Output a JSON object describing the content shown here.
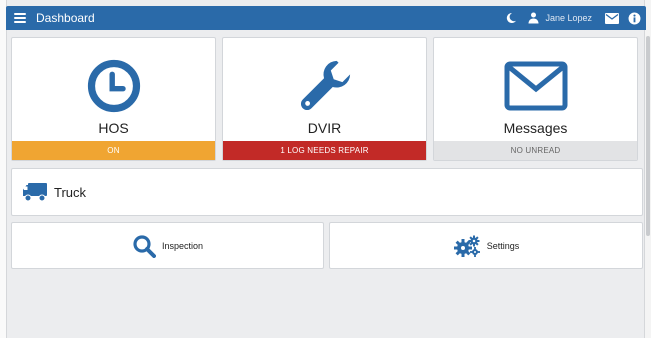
{
  "header": {
    "title": "Dashboard",
    "user_name": "Jane Lopez",
    "icons": [
      "menu-icon",
      "moon-icon",
      "user-icon",
      "envelope-icon",
      "info-icon"
    ]
  },
  "tiles": {
    "hos": {
      "label": "HOS",
      "status": "ON",
      "status_color": "#f0a532",
      "icon": "clock-icon"
    },
    "dvir": {
      "label": "DVIR",
      "status": "1 LOG NEEDS REPAIR",
      "status_color": "#c22a27",
      "icon": "wrench-icon"
    },
    "messages": {
      "label": "Messages",
      "status": "NO UNREAD",
      "status_color": "#e2e3e5",
      "icon": "envelope-icon"
    }
  },
  "truck": {
    "label": "Truck",
    "icon": "truck-icon"
  },
  "inspection": {
    "label": "Inspection",
    "icon": "search-icon"
  },
  "settings": {
    "label": "Settings",
    "icon": "gears-icon"
  },
  "colors": {
    "primary": "#2a6aa9",
    "background": "#ecedef"
  }
}
